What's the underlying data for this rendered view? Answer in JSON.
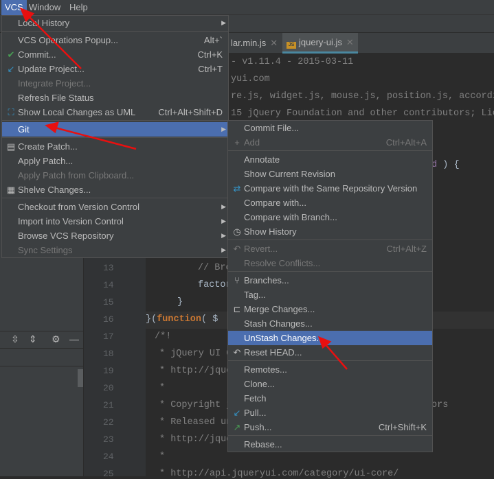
{
  "menubar": {
    "items": [
      {
        "label": "VCS",
        "active": true
      },
      {
        "label": "Window"
      },
      {
        "label": "Help"
      }
    ]
  },
  "tabs": [
    {
      "label": "lar.min.js",
      "active": false
    },
    {
      "label": "jquery-ui.js",
      "active": true,
      "icon": "js-file-icon",
      "icon_text": "JS"
    }
  ],
  "editor": {
    "top_fragments": [
      {
        "line": 1,
        "text": "- v1.11.4 - 2015-03-11"
      },
      {
        "line": 2,
        "text": "yui.com"
      },
      {
        "line": 3,
        "text": "re.js, widget.js, mouse.js, position.js, accordi"
      },
      {
        "line": 4,
        "text": "15 jQuery Foundation and other contributors; Lic"
      }
    ],
    "line7_fragment": {
      "purple": "nd",
      "rest": " ) {"
    },
    "lines": [
      {
        "num": "13",
        "text": "// Bro"
      },
      {
        "num": "14",
        "text": "factor"
      },
      {
        "num": "15",
        "text": "}"
      },
      {
        "num": "16",
        "pre": "}(",
        "keyword": "function",
        "post": "( $"
      },
      {
        "num": "17",
        "text": "/*!"
      },
      {
        "num": "18",
        "text": "* jQuery UI C"
      },
      {
        "num": "19",
        "text": "* http://jque"
      },
      {
        "num": "20",
        "text": "*"
      },
      {
        "num": "21",
        "text": "* Copyright j",
        "tail": "ors"
      },
      {
        "num": "22",
        "text": "* Released un"
      },
      {
        "num": "23",
        "text": "* http://jque"
      },
      {
        "num": "24",
        "text": "*"
      },
      {
        "num": "25",
        "text": "* http://api.jqueryui.com/category/ui-core/"
      }
    ]
  },
  "vcs_menu": [
    {
      "label": "Local History",
      "submenu": true
    },
    {
      "sep": true
    },
    {
      "label": "VCS Operations Popup...",
      "shortcut": "Alt+`"
    },
    {
      "label": "Commit...",
      "shortcut": "Ctrl+K",
      "icon": "check-icon"
    },
    {
      "label": "Update Project...",
      "shortcut": "Ctrl+T",
      "icon": "update-arrow-icon"
    },
    {
      "label": "Integrate Project...",
      "disabled": true
    },
    {
      "label": "Refresh File Status"
    },
    {
      "label": "Show Local Changes as UML",
      "shortcut": "Ctrl+Alt+Shift+D",
      "icon": "uml-icon"
    },
    {
      "sep": true
    },
    {
      "label": "Git",
      "submenu": true,
      "selected": true
    },
    {
      "sep": true
    },
    {
      "label": "Create Patch...",
      "icon": "patch-icon"
    },
    {
      "label": "Apply Patch..."
    },
    {
      "label": "Apply Patch from Clipboard...",
      "disabled": true
    },
    {
      "label": "Shelve Changes...",
      "icon": "shelve-icon"
    },
    {
      "sep": true
    },
    {
      "label": "Checkout from Version Control",
      "submenu": true
    },
    {
      "label": "Import into Version Control",
      "submenu": true
    },
    {
      "label": "Browse VCS Repository",
      "submenu": true
    },
    {
      "label": "Sync Settings",
      "submenu": true,
      "disabled": true
    }
  ],
  "git_menu": [
    {
      "label": "Commit File..."
    },
    {
      "label": "Add",
      "shortcut": "Ctrl+Alt+A",
      "icon": "plus-icon",
      "disabled": true
    },
    {
      "sep": true
    },
    {
      "label": "Annotate"
    },
    {
      "label": "Show Current Revision"
    },
    {
      "label": "Compare with the Same Repository Version",
      "icon": "compare-icon"
    },
    {
      "label": "Compare with..."
    },
    {
      "label": "Compare with Branch..."
    },
    {
      "label": "Show History",
      "icon": "clock-icon"
    },
    {
      "sep": true
    },
    {
      "label": "Revert...",
      "shortcut": "Ctrl+Alt+Z",
      "icon": "revert-icon",
      "disabled": true
    },
    {
      "label": "Resolve Conflicts...",
      "disabled": true
    },
    {
      "sep": true
    },
    {
      "label": "Branches...",
      "icon": "branch-icon"
    },
    {
      "label": "Tag..."
    },
    {
      "label": "Merge Changes...",
      "icon": "merge-icon"
    },
    {
      "label": "Stash Changes..."
    },
    {
      "label": "UnStash Changes...",
      "selected": true
    },
    {
      "label": "Reset HEAD...",
      "icon": "reset-icon"
    },
    {
      "sep": true
    },
    {
      "label": "Remotes..."
    },
    {
      "label": "Clone..."
    },
    {
      "label": "Fetch"
    },
    {
      "label": "Pull...",
      "icon": "pull-arrow-icon"
    },
    {
      "label": "Push...",
      "shortcut": "Ctrl+Shift+K",
      "icon": "push-arrow-icon"
    },
    {
      "sep": true
    },
    {
      "label": "Rebase..."
    }
  ],
  "colors": {
    "menu_bg": "#3c3f41",
    "selection": "#4b6eaf",
    "annotation_arrow": "#e81010",
    "keyword": "#cc7832"
  }
}
